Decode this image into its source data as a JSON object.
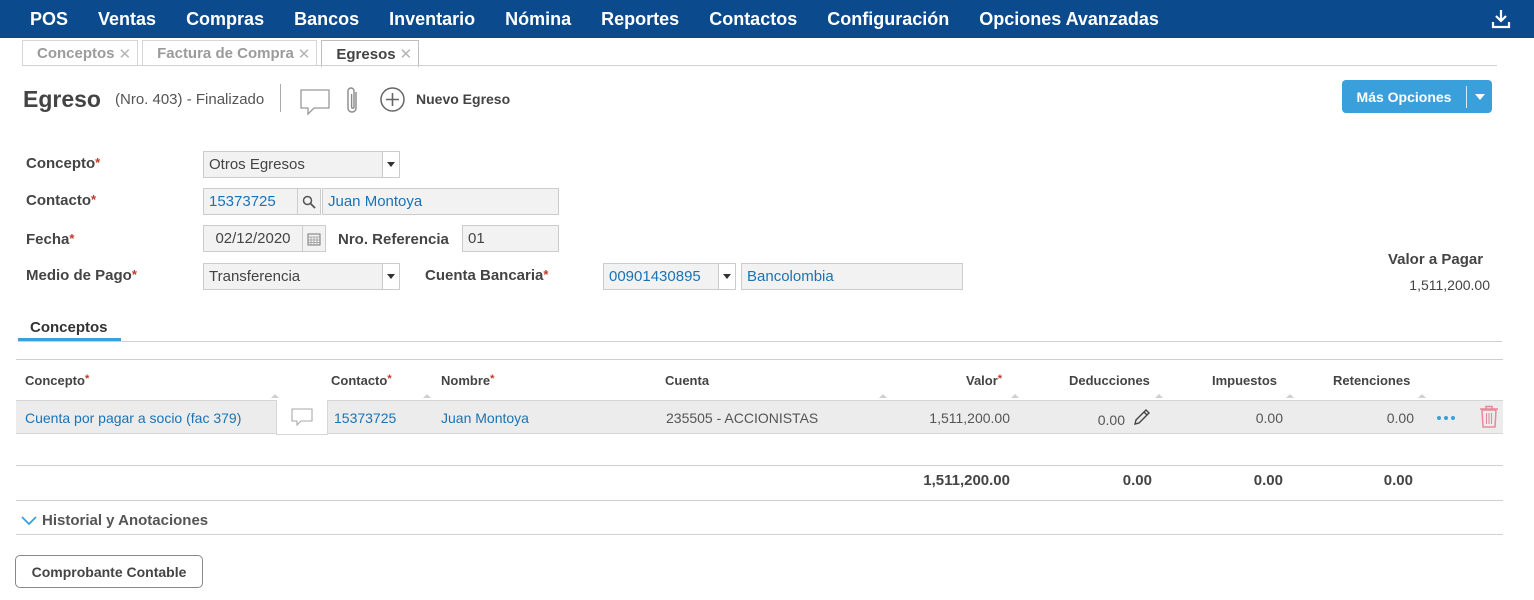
{
  "topnav": {
    "items": [
      "POS",
      "Ventas",
      "Compras",
      "Bancos",
      "Inventario",
      "Nómina",
      "Reportes",
      "Contactos",
      "Configuración",
      "Opciones Avanzadas"
    ],
    "bg_color": "#0b4a8d"
  },
  "tabs": [
    {
      "label": "Conceptos",
      "active": false
    },
    {
      "label": "Factura de Compra",
      "active": false
    },
    {
      "label": "Egresos",
      "active": true
    }
  ],
  "header": {
    "title": "Egreso",
    "subtitle": "(Nro. 403) - Finalizado",
    "new_label": "Nuevo Egreso",
    "more_options": "Más Opciones"
  },
  "form": {
    "concepto": {
      "label": "Concepto",
      "value": "Otros Egresos"
    },
    "contacto": {
      "label": "Contacto",
      "id": "15373725",
      "name": "Juan Montoya"
    },
    "fecha": {
      "label": "Fecha",
      "value": "02/12/2020"
    },
    "referencia": {
      "label": "Nro. Referencia",
      "value": "01"
    },
    "medio_pago": {
      "label": "Medio de Pago",
      "value": "Transferencia"
    },
    "cuenta_bancaria": {
      "label": "Cuenta Bancaria",
      "number": "00901430895",
      "bank": "Bancolombia"
    },
    "required_mark": "*"
  },
  "valor_pagar": {
    "label": "Valor a Pagar",
    "value": "1,511,200.00"
  },
  "section_tab": "Conceptos",
  "table": {
    "columns": [
      "Concepto",
      "Contacto",
      "Nombre",
      "Cuenta",
      "Valor",
      "Deducciones",
      "Impuestos",
      "Retenciones"
    ],
    "rows": [
      {
        "concepto": "Cuenta por pagar a socio (fac 379)",
        "contacto": "15373725",
        "nombre": "Juan Montoya",
        "cuenta": "235505 - ACCIONISTAS",
        "valor": "1,511,200.00",
        "deducciones": "0.00",
        "impuestos": "0.00",
        "retenciones": "0.00"
      }
    ],
    "totals": {
      "valor": "1,511,200.00",
      "deducciones": "0.00",
      "impuestos": "0.00",
      "retenciones": "0.00"
    }
  },
  "historial": "Historial y Anotaciones",
  "comprobante_button": "Comprobante Contable",
  "accent_color": "#3aa0dc"
}
